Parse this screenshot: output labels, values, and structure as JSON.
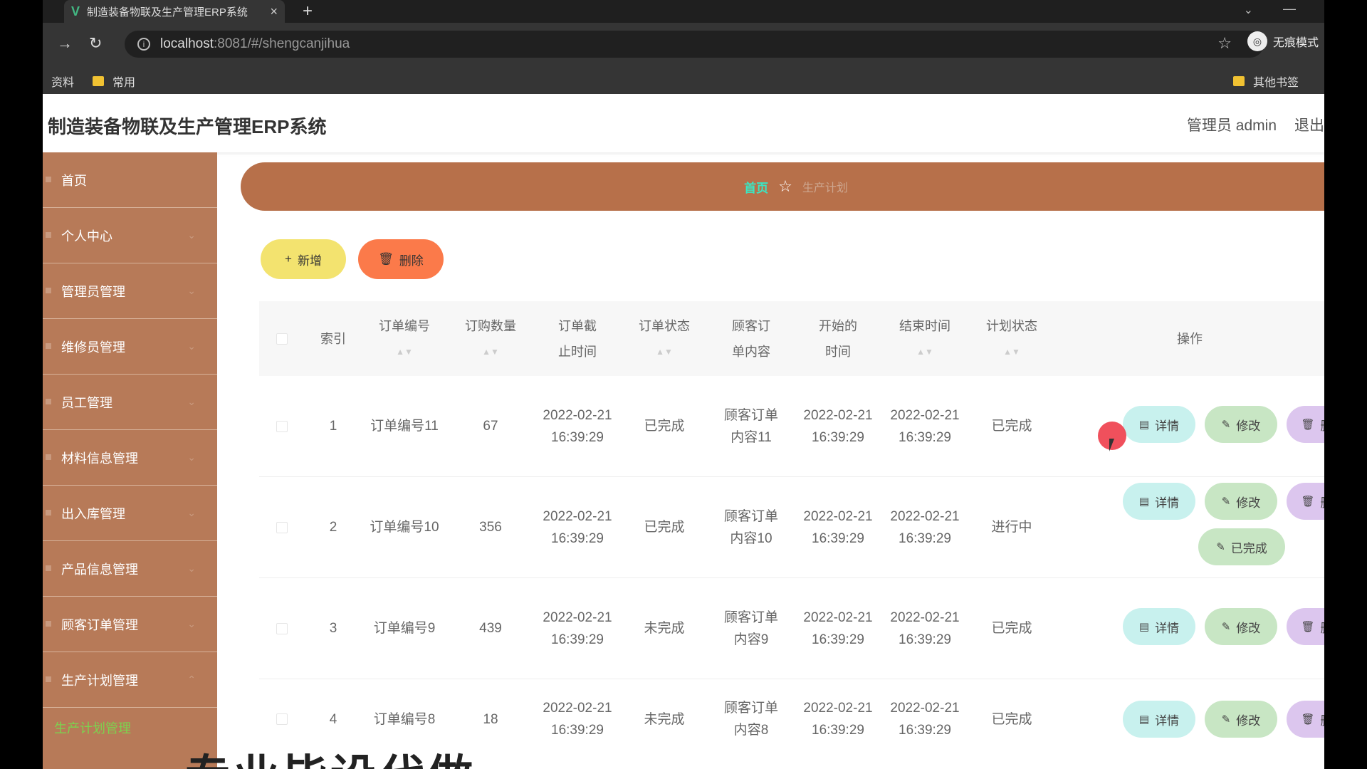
{
  "browser": {
    "tab_title": "制造装备物联及生产管理ERP系统",
    "tab_logo": "V",
    "close_glyph": "×",
    "new_tab_glyph": "+",
    "url_host": "localhost",
    "url_path": ":8081/#/shengcanjihua",
    "profile_label": "无痕模式",
    "bookmarks": [
      "资料",
      "常用"
    ],
    "other_bookmarks": "其他书签"
  },
  "app": {
    "title": "制造装备物联及生产管理ERP系统",
    "user": "管理员 admin",
    "logout": "退出"
  },
  "sidebar": {
    "items": [
      "首页",
      "个人中心",
      "管理员管理",
      "维修员管理",
      "员工管理",
      "材料信息管理",
      "出入库管理",
      "产品信息管理",
      "顾客订单管理",
      "生产计划管理"
    ],
    "active_sub": "生产计划管理"
  },
  "breadcrumb": {
    "home": "首页",
    "current": "生产计划"
  },
  "toolbar": {
    "add": "新增",
    "delete": "删除"
  },
  "table": {
    "headers": {
      "index": "索引",
      "order_no": "订单编号",
      "qty": "订购数量",
      "deadline": "订单截止时间",
      "order_status": "订单状态",
      "customer_order": "顾客订单内容",
      "start": "开始的时间",
      "end": "结束时间",
      "plan_status": "计划状态",
      "actions": "操作"
    },
    "rows": [
      {
        "index": "1",
        "order_no": "订单编号11",
        "qty": "67",
        "deadline": "2022-02-21 16:39:29",
        "order_status": "已完成",
        "customer_order": "顾客订单内容11",
        "start": "2022-02-21 16:39:29",
        "end": "2022-02-21 16:39:29",
        "plan_status": "已完成"
      },
      {
        "index": "2",
        "order_no": "订单编号10",
        "qty": "356",
        "deadline": "2022-02-21 16:39:29",
        "order_status": "已完成",
        "customer_order": "顾客订单内容10",
        "start": "2022-02-21 16:39:29",
        "end": "2022-02-21 16:39:29",
        "plan_status": "进行中"
      },
      {
        "index": "3",
        "order_no": "订单编号9",
        "qty": "439",
        "deadline": "2022-02-21 16:39:29",
        "order_status": "未完成",
        "customer_order": "顾客订单内容9",
        "start": "2022-02-21 16:39:29",
        "end": "2022-02-21 16:39:29",
        "plan_status": "已完成"
      },
      {
        "index": "4",
        "order_no": "订单编号8",
        "qty": "18",
        "deadline": "2022-02-21 16:39:29",
        "order_status": "未完成",
        "customer_order": "顾客订单内容8",
        "start": "2022-02-21 16:39:29",
        "end": "2022-02-21 16:39:29",
        "plan_status": "已完成"
      }
    ],
    "actions": {
      "detail": "详情",
      "edit": "修改",
      "delete": "删除",
      "complete": "已完成"
    }
  },
  "caption": "专业毕设代做"
}
